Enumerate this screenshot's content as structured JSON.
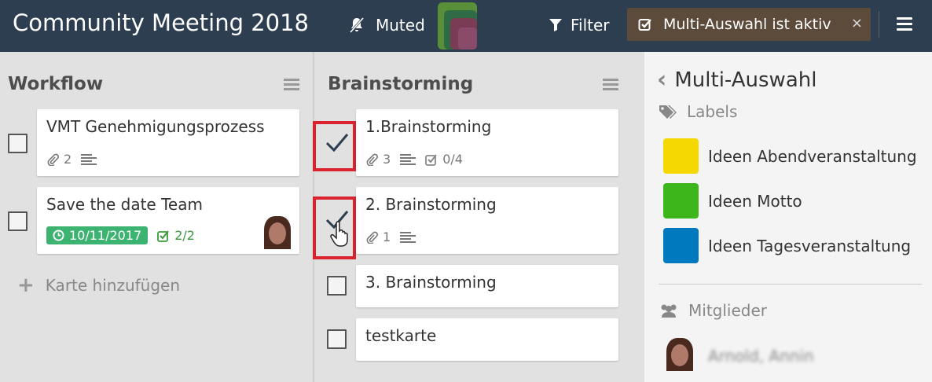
{
  "header": {
    "board_title": "Community Meeting 2018",
    "muted_label": "Muted",
    "filter_label": "Filter",
    "multiselect_label": "Multi-Auswahl ist aktiv",
    "close_symbol": "×",
    "colors": {
      "bar": "#2c3e50",
      "pill": "#5c4a3a"
    }
  },
  "lists": [
    {
      "title": "Workflow",
      "cards": [
        {
          "title": "VMT Genehmigungsprozess",
          "attachments": "2",
          "has_description": true
        },
        {
          "title": "Save the date Team",
          "due_date": "10/11/2017",
          "checklist": "2/2",
          "has_member": true
        }
      ],
      "add_card_label": "Karte hinzufügen"
    },
    {
      "title": "Brainstorming",
      "cards": [
        {
          "title": "1.Brainstorming",
          "attachments": "3",
          "has_description": true,
          "checklist": "0/4",
          "selected": true
        },
        {
          "title": "2. Brainstorming",
          "attachments": "1",
          "has_description": true,
          "selected": true
        },
        {
          "title": "3. Brainstorming",
          "selected": false
        },
        {
          "title": "testkarte",
          "selected": false
        }
      ]
    }
  ],
  "sidebar": {
    "title": "Multi-Auswahl",
    "labels_heading": "Labels",
    "labels": [
      {
        "name": "Ideen Abendveranstaltung",
        "color": "#f5d800"
      },
      {
        "name": "Ideen Motto",
        "color": "#3db61c"
      },
      {
        "name": "Ideen Tagesveranstaltung",
        "color": "#0079bf"
      }
    ],
    "members_heading": "Mitglieder",
    "members": [
      {
        "name": "Arnold, Annin"
      }
    ]
  }
}
